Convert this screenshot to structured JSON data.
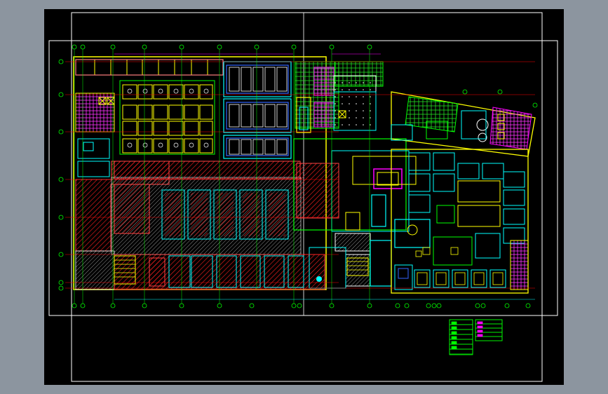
{
  "app": {
    "title": "",
    "canvas_background": "#000000",
    "window_background": "#8c959f"
  },
  "drawing": {
    "kind": "architectural floor plan (CAD)",
    "grid_bubble_color": "#00ff00",
    "grid_line_color": "#ff0000",
    "wall_color": "#ffff00",
    "hatch_color": "#ff0000",
    "furniture_color": "#00ffff",
    "highlight_color": "#ff00ff",
    "sheet_border_color": "#ffffff"
  },
  "legend": {
    "icon": "legend-table-icon",
    "colors": [
      "#00ff00",
      "#ff00ff",
      "#ffffff"
    ]
  }
}
